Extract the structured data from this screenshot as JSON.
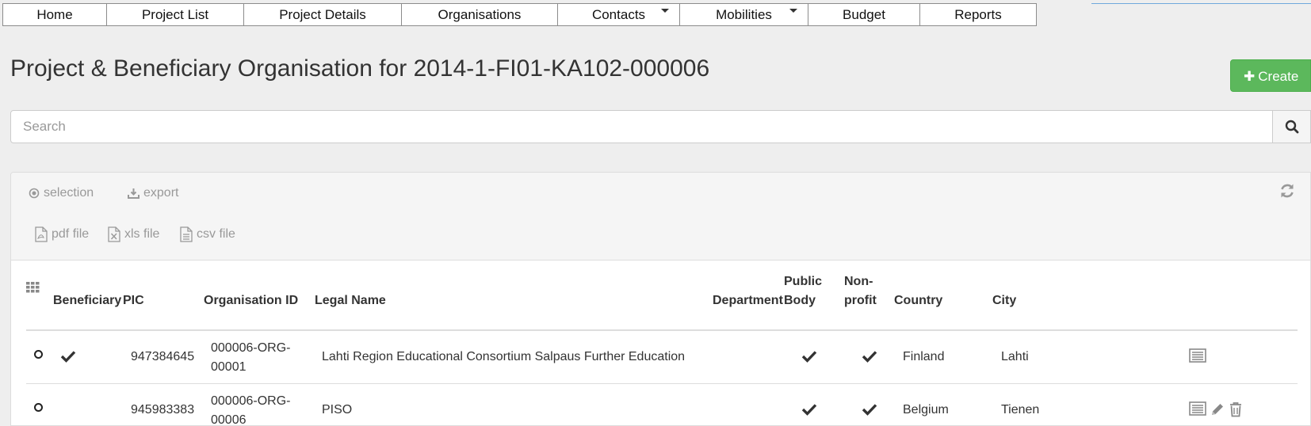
{
  "nav": {
    "items": [
      {
        "label": "Home"
      },
      {
        "label": "Project List"
      },
      {
        "label": "Project Details"
      },
      {
        "label": "Organisations"
      },
      {
        "label": "Contacts"
      },
      {
        "label": "Mobilities"
      },
      {
        "label": "Budget"
      },
      {
        "label": "Reports"
      }
    ]
  },
  "page": {
    "title": "Project & Beneficiary Organisation for 2014-1-FI01-KA102-000006",
    "create_label": "Create"
  },
  "search": {
    "placeholder": "Search",
    "value": ""
  },
  "toolbar": {
    "selection_label": "selection",
    "export_label": "export",
    "pdf_label": "pdf file",
    "xls_label": "xls file",
    "csv_label": "csv file"
  },
  "table": {
    "columns": {
      "beneficiary": "Beneficiary",
      "pic": "PIC",
      "org_id": "Organisation ID",
      "legal_name": "Legal Name",
      "department": "Department",
      "public_body": "Public Body",
      "non_profit": "Non-profit",
      "country": "Country",
      "city": "City"
    },
    "rows": [
      {
        "beneficiary": true,
        "pic": "947384645",
        "org_id": "000006-ORG-00001",
        "legal_name": "Lahti Region Educational Consortium Salpaus Further Education",
        "department": "",
        "public_body": true,
        "non_profit": true,
        "country": "Finland",
        "city": "Lahti"
      },
      {
        "beneficiary": false,
        "pic": "945983383",
        "org_id": "000006-ORG-00006",
        "legal_name": "PISO",
        "department": "",
        "public_body": true,
        "non_profit": true,
        "country": "Belgium",
        "city": "Tienen"
      }
    ]
  },
  "colors": {
    "create_button": "#5cb85c",
    "muted_text": "#999999",
    "background": "#eeeeee"
  },
  "icons": {
    "nav_dropdown": "caret-down-icon",
    "search": "search-icon",
    "refresh": "refresh-icon",
    "selection": "radio-dot-icon",
    "export": "download-icon",
    "pdf": "pdf-file-icon",
    "xls": "xls-file-icon",
    "csv": "csv-file-icon",
    "columns": "grid-icon",
    "check": "checkmark-icon",
    "details": "details-icon",
    "edit": "pencil-icon",
    "delete": "trash-icon"
  }
}
